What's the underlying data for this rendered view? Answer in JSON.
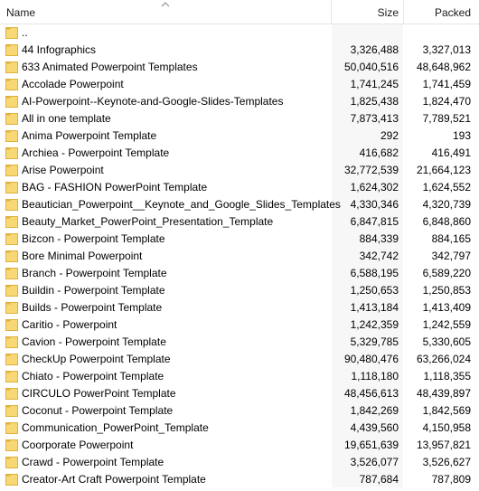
{
  "columns": {
    "name": "Name",
    "size": "Size",
    "packed": "Packed"
  },
  "accent": {
    "folder": "#f8d775",
    "folder_dark": "#e0b13c"
  },
  "rows": [
    {
      "name": "..",
      "size": "",
      "packed": ""
    },
    {
      "name": "44 Infographics",
      "size": "3,326,488",
      "packed": "3,327,013"
    },
    {
      "name": "633 Animated Powerpoint Templates",
      "size": "50,040,516",
      "packed": "48,648,962"
    },
    {
      "name": "Accolade Powerpoint",
      "size": "1,741,245",
      "packed": "1,741,459"
    },
    {
      "name": "AI-Powerpoint--Keynote-and-Google-Slides-Templates",
      "size": "1,825,438",
      "packed": "1,824,470"
    },
    {
      "name": "All in one template",
      "size": "7,873,413",
      "packed": "7,789,521"
    },
    {
      "name": "Anima Powerpoint Template",
      "size": "292",
      "packed": "193"
    },
    {
      "name": "Archiea - Powerpoint Template",
      "size": "416,682",
      "packed": "416,491"
    },
    {
      "name": "Arise Powerpoint",
      "size": "32,772,539",
      "packed": "21,664,123"
    },
    {
      "name": "BAG - FASHION PowerPoint Template",
      "size": "1,624,302",
      "packed": "1,624,552"
    },
    {
      "name": "Beautician_Powerpoint__Keynote_and_Google_Slides_Templates",
      "size": "4,330,346",
      "packed": "4,320,739"
    },
    {
      "name": "Beauty_Market_PowerPoint_Presentation_Template",
      "size": "6,847,815",
      "packed": "6,848,860"
    },
    {
      "name": "Bizcon - Powerpoint Template",
      "size": "884,339",
      "packed": "884,165"
    },
    {
      "name": "Bore Minimal Powerpoint",
      "size": "342,742",
      "packed": "342,797"
    },
    {
      "name": "Branch - Powerpoint Template",
      "size": "6,588,195",
      "packed": "6,589,220"
    },
    {
      "name": "Buildin - Powerpoint Template",
      "size": "1,250,653",
      "packed": "1,250,853"
    },
    {
      "name": "Builds - Powerpoint Template",
      "size": "1,413,184",
      "packed": "1,413,409"
    },
    {
      "name": "Caritio - Powerpoint",
      "size": "1,242,359",
      "packed": "1,242,559"
    },
    {
      "name": "Cavion - Powerpoint Template",
      "size": "5,329,785",
      "packed": "5,330,605"
    },
    {
      "name": "CheckUp Powerpoint Template",
      "size": "90,480,476",
      "packed": "63,266,024"
    },
    {
      "name": "Chiato - Powerpoint Template",
      "size": "1,118,180",
      "packed": "1,118,355"
    },
    {
      "name": "CIRCULO PowerPoint Template",
      "size": "48,456,613",
      "packed": "48,439,897"
    },
    {
      "name": "Coconut - Powerpoint Template",
      "size": "1,842,269",
      "packed": "1,842,569"
    },
    {
      "name": "Communication_PowerPoint_Template",
      "size": "4,439,560",
      "packed": "4,150,958"
    },
    {
      "name": "Coorporate Powerpoint",
      "size": "19,651,639",
      "packed": "13,957,821"
    },
    {
      "name": "Crawd - Powerpoint Template",
      "size": "3,526,077",
      "packed": "3,526,627"
    },
    {
      "name": "Creator-Art Craft Powerpoint Template",
      "size": "787,684",
      "packed": "787,809"
    }
  ]
}
